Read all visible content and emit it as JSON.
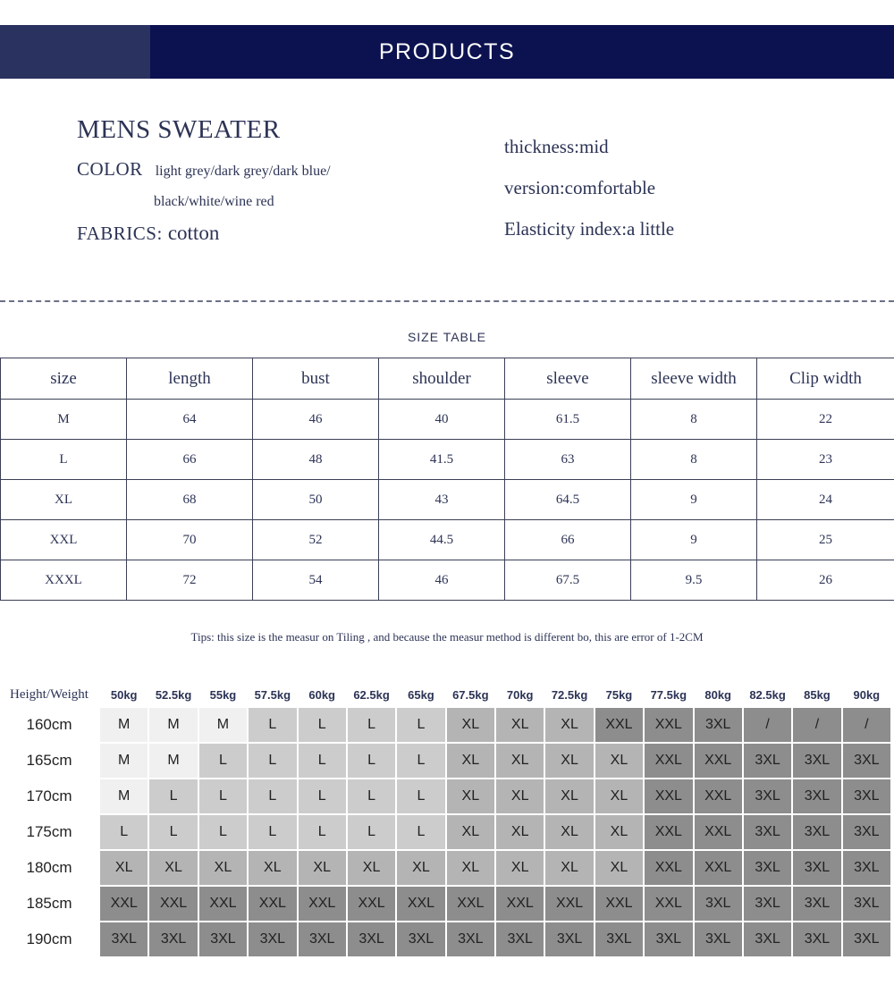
{
  "banner": {
    "title": "PRODUCTS",
    "bg_color": "#0c1250",
    "accent_color": "#2a3260"
  },
  "product": {
    "title": "MENS SWEATER",
    "color_label": "COLOR",
    "color_value_line1": "light grey/dark grey/dark blue/",
    "color_value_line2": "black/white/wine red",
    "fabrics_label": "FABRICS:",
    "fabrics_value": "cotton",
    "thickness": "thickness:mid",
    "version": "version:comfortable",
    "elasticity": "Elasticity index:a little"
  },
  "size_table": {
    "title": "SIZE TABLE",
    "headers": [
      "size",
      "length",
      "bust",
      "shoulder",
      "sleeve",
      "sleeve width",
      "Clip width"
    ],
    "rows": [
      [
        "M",
        "64",
        "46",
        "40",
        "61.5",
        "8",
        "22"
      ],
      [
        "L",
        "66",
        "48",
        "41.5",
        "63",
        "8",
        "23"
      ],
      [
        "XL",
        "68",
        "50",
        "43",
        "64.5",
        "9",
        "24"
      ],
      [
        "XXL",
        "70",
        "52",
        "44.5",
        "66",
        "9",
        "25"
      ],
      [
        "XXXL",
        "72",
        "54",
        "46",
        "67.5",
        "9.5",
        "26"
      ]
    ],
    "tips": "Tips: this size is the measur on Tiling , and because the measur method is different bo, this are error of 1-2CM"
  },
  "matrix": {
    "corner_label": "Height/Weight",
    "weights": [
      "50kg",
      "52.5kg",
      "55kg",
      "57.5kg",
      "60kg",
      "62.5kg",
      "65kg",
      "67.5kg",
      "70kg",
      "72.5kg",
      "75kg",
      "77.5kg",
      "80kg",
      "82.5kg",
      "85kg",
      "90kg"
    ],
    "heights": [
      "160cm",
      "165cm",
      "170cm",
      "175cm",
      "180cm",
      "185cm",
      "190cm"
    ],
    "cells": [
      [
        "M",
        "M",
        "M",
        "L",
        "L",
        "L",
        "L",
        "XL",
        "XL",
        "XL",
        "XXL",
        "XXL",
        "3XL",
        "/",
        "/",
        "/"
      ],
      [
        "M",
        "M",
        "L",
        "L",
        "L",
        "L",
        "L",
        "XL",
        "XL",
        "XL",
        "XL",
        "XXL",
        "XXL",
        "3XL",
        "3XL",
        "3XL"
      ],
      [
        "M",
        "L",
        "L",
        "L",
        "L",
        "L",
        "L",
        "XL",
        "XL",
        "XL",
        "XL",
        "XXL",
        "XXL",
        "3XL",
        "3XL",
        "3XL"
      ],
      [
        "L",
        "L",
        "L",
        "L",
        "L",
        "L",
        "L",
        "XL",
        "XL",
        "XL",
        "XL",
        "XXL",
        "XXL",
        "3XL",
        "3XL",
        "3XL"
      ],
      [
        "XL",
        "XL",
        "XL",
        "XL",
        "XL",
        "XL",
        "XL",
        "XL",
        "XL",
        "XL",
        "XL",
        "XXL",
        "XXL",
        "3XL",
        "3XL",
        "3XL"
      ],
      [
        "XXL",
        "XXL",
        "XXL",
        "XXL",
        "XXL",
        "XXL",
        "XXL",
        "XXL",
        "XXL",
        "XXL",
        "XXL",
        "XXL",
        "3XL",
        "3XL",
        "3XL",
        "3XL"
      ],
      [
        "3XL",
        "3XL",
        "3XL",
        "3XL",
        "3XL",
        "3XL",
        "3XL",
        "3XL",
        "3XL",
        "3XL",
        "3XL",
        "3XL",
        "3XL",
        "3XL",
        "3XL",
        "3XL"
      ]
    ],
    "legend_colors": {
      "M": "#f0f0f0",
      "L": "#cccccc",
      "XL": "#b4b4b4",
      "XXL": "#8d8d8d",
      "3XL": "#8d8d8d",
      "/": "#8d8d8d"
    }
  }
}
